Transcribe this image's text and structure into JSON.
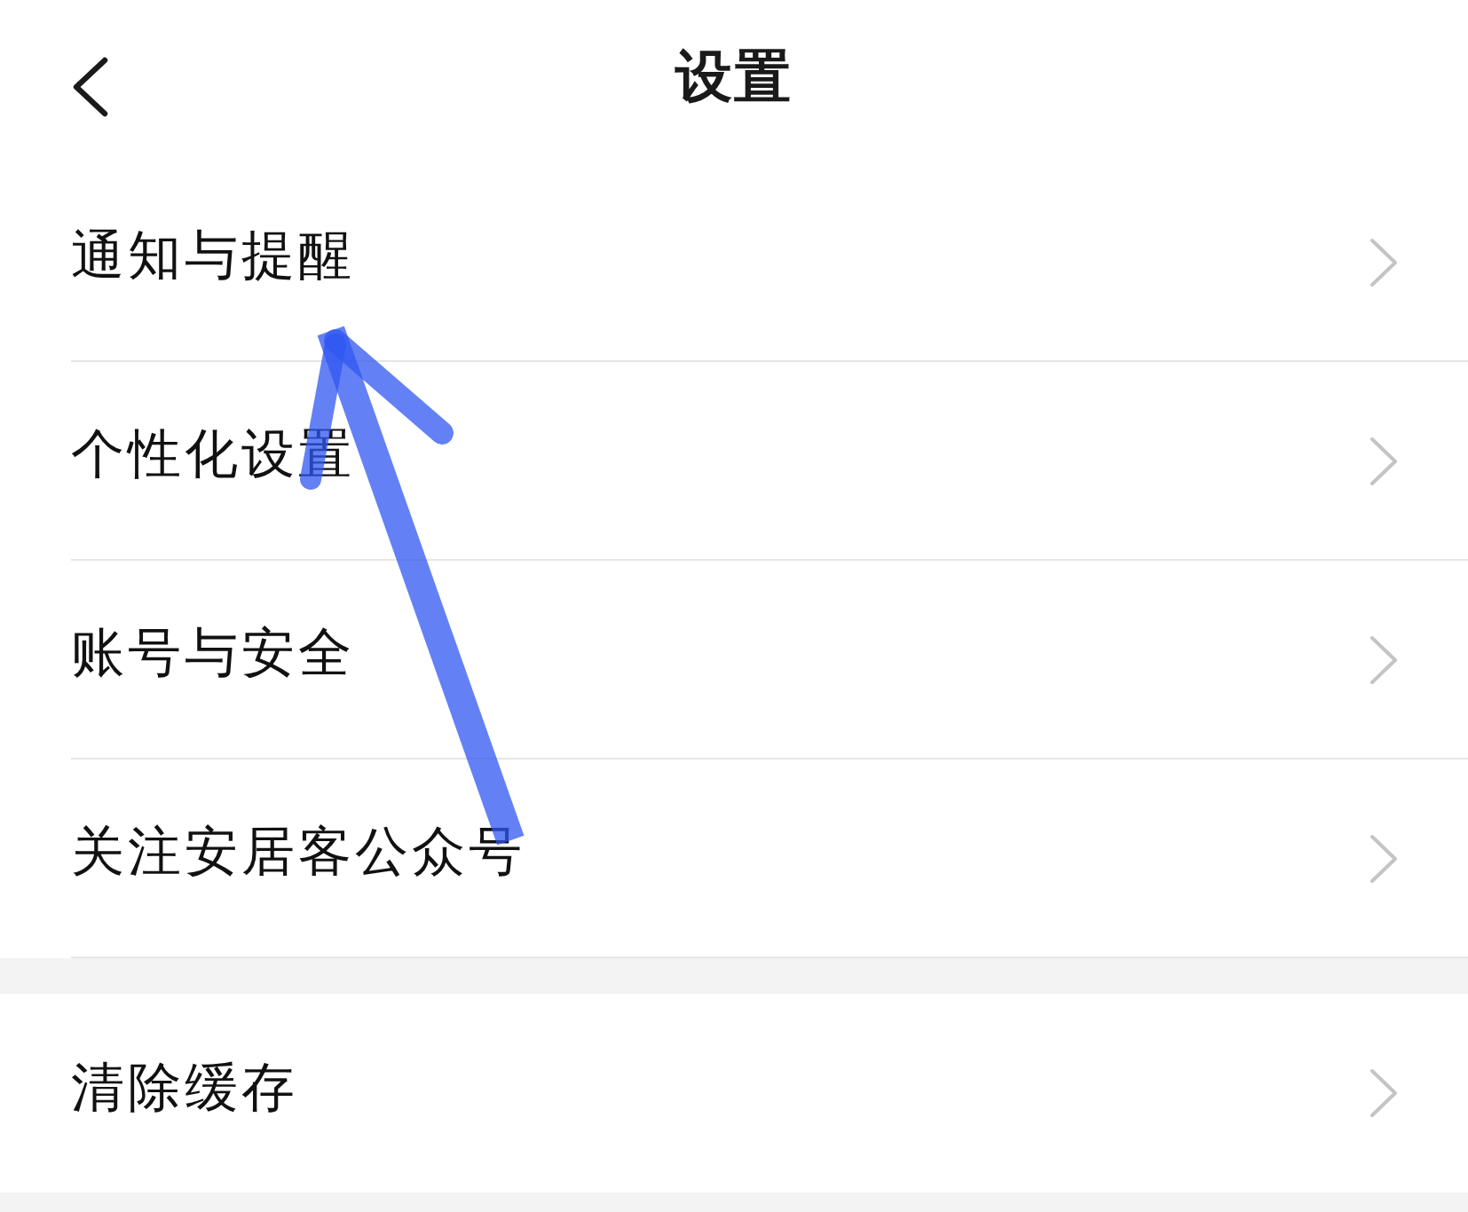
{
  "header": {
    "title": "设置"
  },
  "sections": [
    {
      "items": [
        {
          "label": "通知与提醒"
        },
        {
          "label": "个性化设置"
        },
        {
          "label": "账号与安全"
        },
        {
          "label": "关注安居客公众号"
        }
      ]
    },
    {
      "items": [
        {
          "label": "清除缓存"
        }
      ]
    }
  ]
}
